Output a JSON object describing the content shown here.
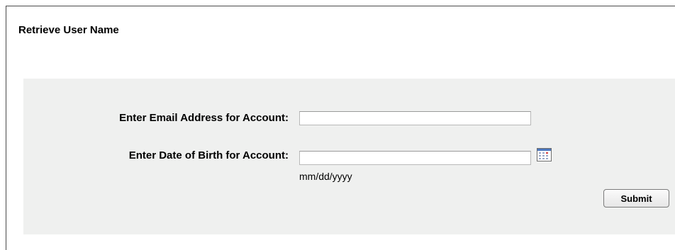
{
  "form": {
    "title": "Retrieve User Name",
    "email_label": "Enter Email Address for Account:",
    "email_value": "",
    "dob_label": "Enter Date of Birth for Account:",
    "dob_value": "",
    "dob_hint": "mm/dd/yyyy",
    "submit_label": "Submit",
    "calendar_icon": "calendar-icon"
  },
  "colors": {
    "panel_background": "#eff0ef",
    "page_background": "#ffffff"
  }
}
